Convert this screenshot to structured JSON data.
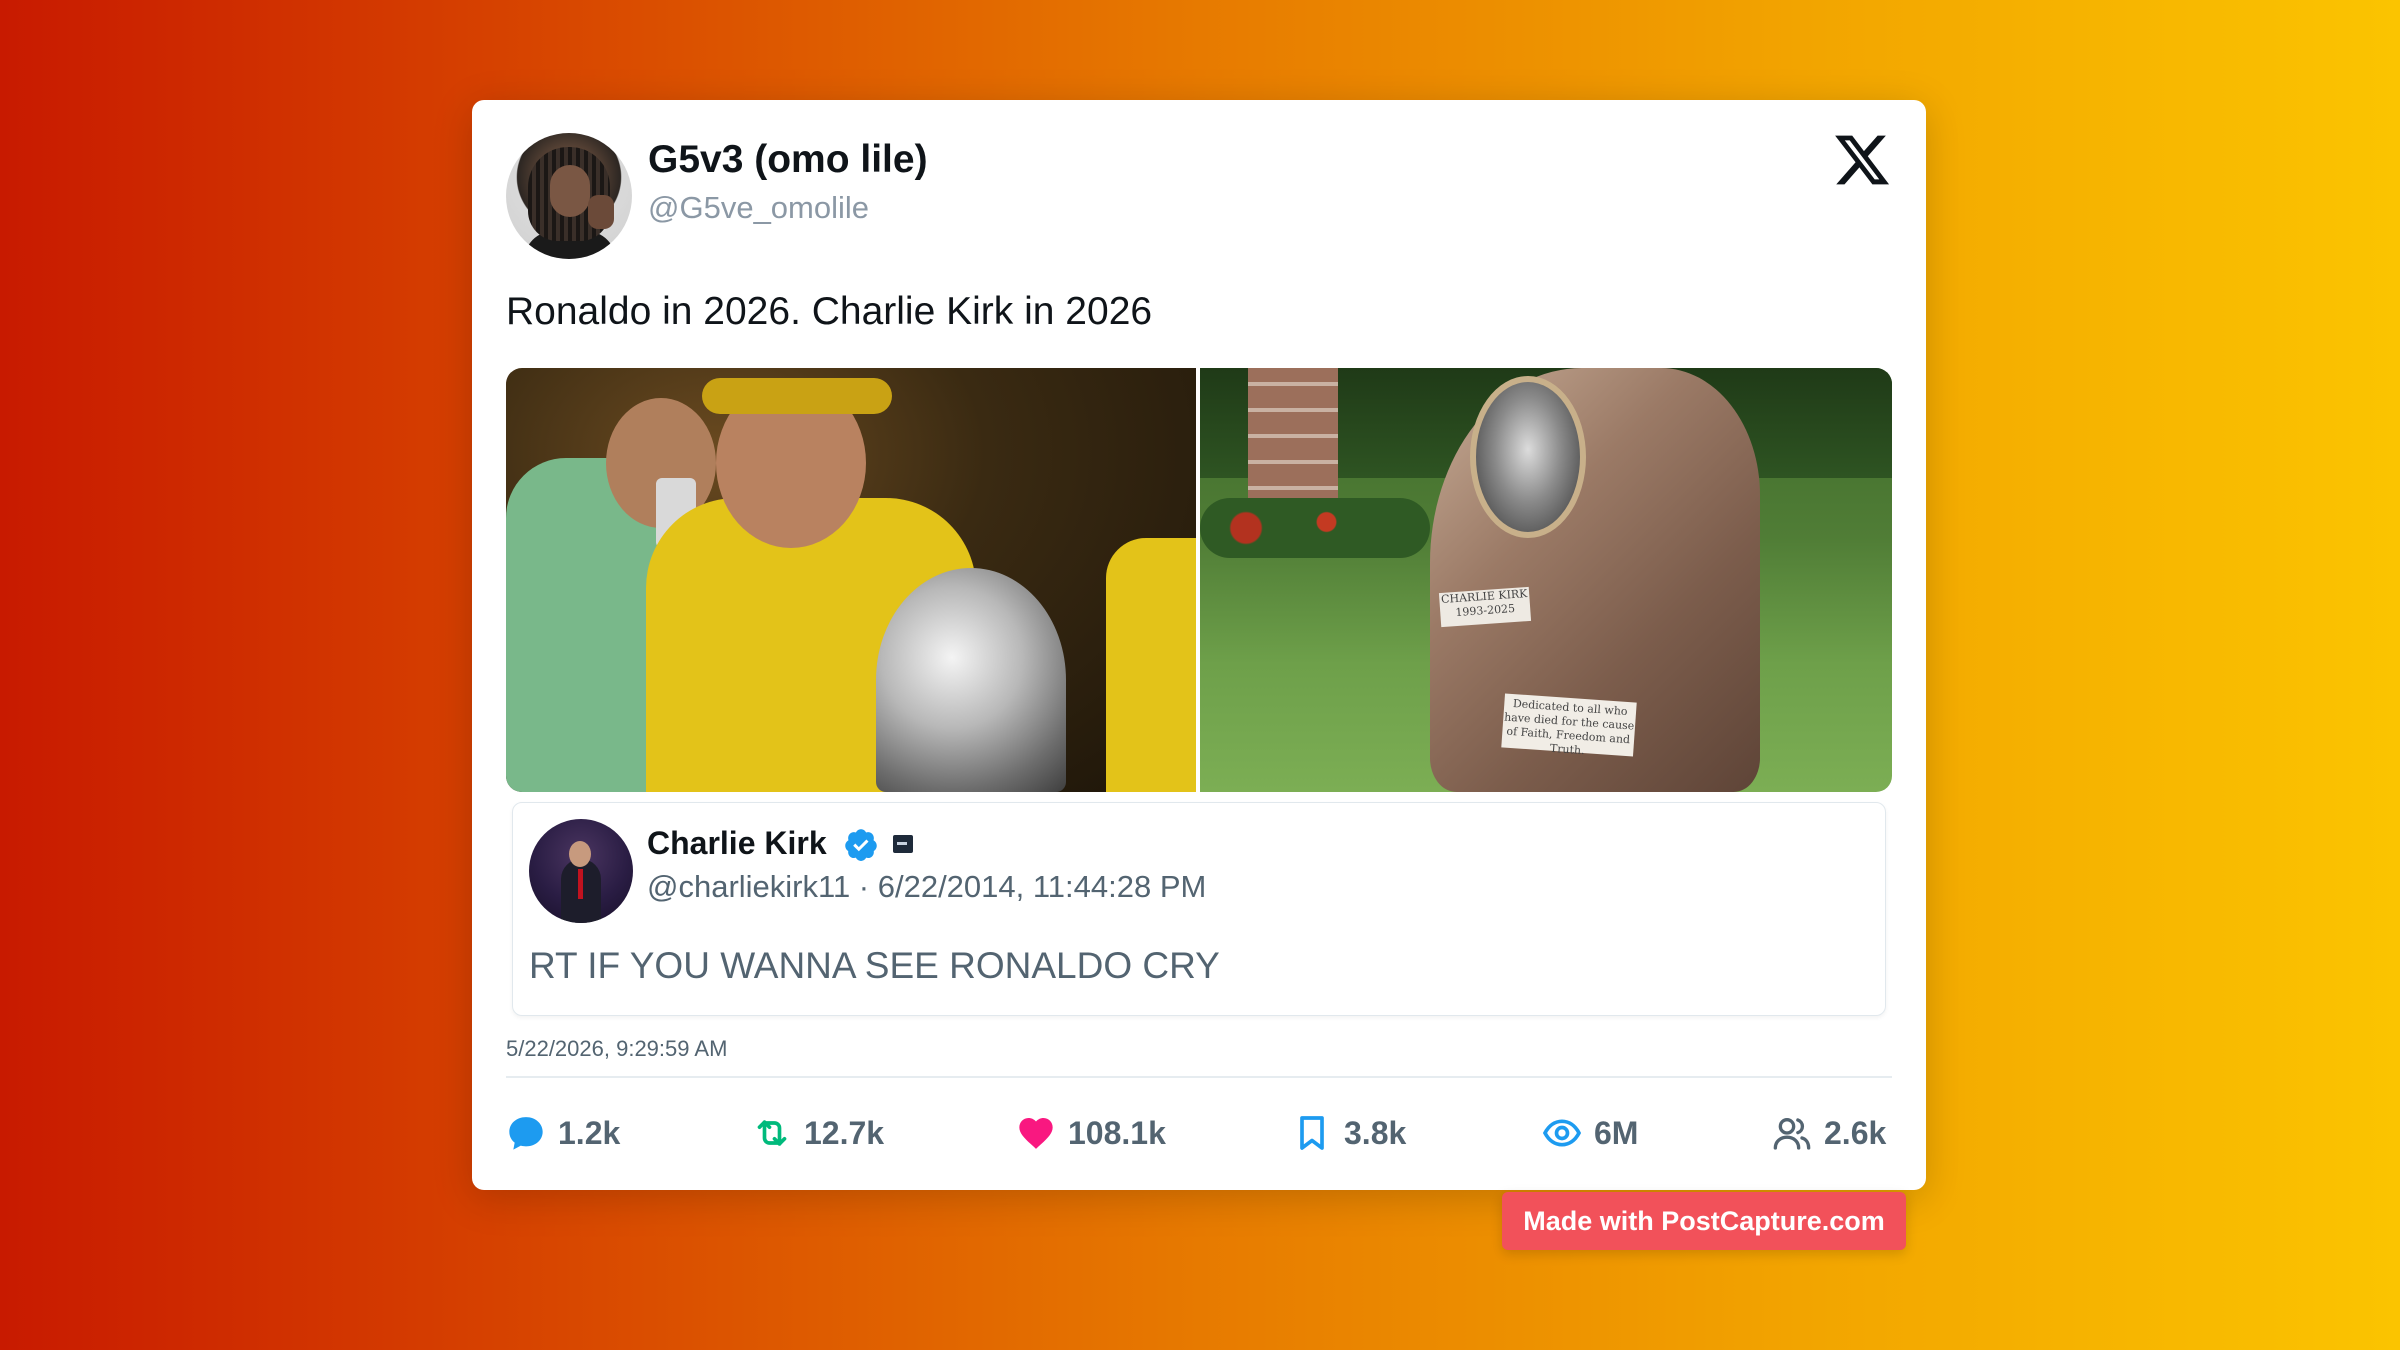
{
  "author": {
    "name": "G5v3 (omo lile)",
    "handle": "@G5ve_omolile"
  },
  "tweet": {
    "text": "Ronaldo in 2026. Charlie Kirk in 2026",
    "timestamp": "5/22/2026, 9:29:59 AM"
  },
  "media": {
    "plaque_name": "CHARLIE KIRK",
    "plaque_years": "1993-2025",
    "plaque_dedication": "Dedicated to all who have died for the cause of Faith, Freedom and Truth."
  },
  "quoted": {
    "name": "Charlie Kirk",
    "handle_time": "@charliekirk11 · 6/22/2014, 11:44:28 PM",
    "text": "RT IF YOU WANNA SEE RONALDO CRY"
  },
  "stats": {
    "replies": "1.2k",
    "retweets": "12.7k",
    "likes": "108.1k",
    "bookmarks": "3.8k",
    "views": "6M",
    "followers": "2.6k"
  },
  "colors": {
    "reply": "#1d9bf0",
    "retweet": "#00ba7c",
    "like": "#f91880",
    "bookmark": "#1d9bf0",
    "views": "#1d9bf0"
  },
  "watermark": "Made with PostCapture.com"
}
